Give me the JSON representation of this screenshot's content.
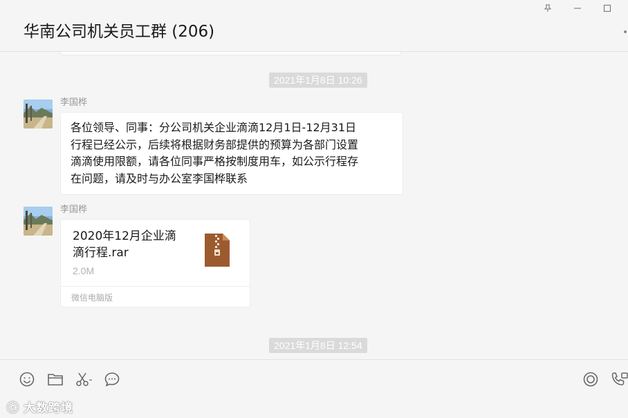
{
  "window": {
    "title": "华南公司机关员工群 (206)",
    "pin_icon": "pin-icon",
    "minimize_icon": "minimize-icon",
    "maximize_icon": "maximize-icon"
  },
  "messages": [
    {
      "type": "timestamp",
      "text": "2021年1月8日 10:26"
    },
    {
      "type": "text",
      "sender": "李国桦",
      "lines": [
        "各位领导、同事：分公司机关企业滴滴12月1日-12月31日",
        "行程已经公示，后续将根据财务部提供的预算为各部门设置",
        "滴滴使用限额，请各位同事严格按制度用车，如公示行程存",
        "在问题，请及时与办公室李国桦联系"
      ]
    },
    {
      "type": "file",
      "sender": "李国桦",
      "file_name_lines": [
        "2020年12月企业滴",
        "滴行程.rar"
      ],
      "file_size": "2.0M",
      "source": "微信电脑版",
      "icon": "archive-file-icon"
    },
    {
      "type": "timestamp",
      "text": "2021年1月8日 12:54"
    }
  ],
  "toolbar": {
    "left_icons": [
      "emoji-icon",
      "folder-icon",
      "scissors-icon",
      "chat-history-icon"
    ],
    "right_icons": [
      "live-icon",
      "call-icon"
    ]
  },
  "watermark": "大数跨境",
  "colors": {
    "background": "#f5f5f5",
    "bubble": "#ffffff",
    "timestamp_bg": "#dadada",
    "file_icon": "#9c5b2f"
  }
}
